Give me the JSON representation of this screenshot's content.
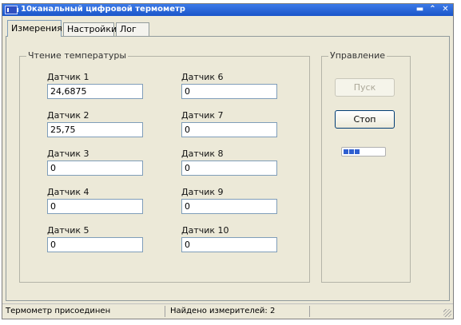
{
  "window": {
    "title": "10канальный цифровой термометр",
    "buttons": {
      "minimize": "▬",
      "maximize": "⌃",
      "close": "✕"
    }
  },
  "tabs": [
    {
      "label": "Измерения"
    },
    {
      "label": "Настройки"
    },
    {
      "label": "Лог"
    }
  ],
  "measurements": {
    "group_title": "Чтение температуры",
    "sensors": [
      {
        "label": "Датчик 1",
        "value": "24,6875"
      },
      {
        "label": "Датчик 2",
        "value": "25,75"
      },
      {
        "label": "Датчик 3",
        "value": "0"
      },
      {
        "label": "Датчик 4",
        "value": "0"
      },
      {
        "label": "Датчик 5",
        "value": "0"
      },
      {
        "label": "Датчик 6",
        "value": "0"
      },
      {
        "label": "Датчик 7",
        "value": "0"
      },
      {
        "label": "Датчик 8",
        "value": "0"
      },
      {
        "label": "Датчик 9",
        "value": "0"
      },
      {
        "label": "Датчик 10",
        "value": "0"
      }
    ]
  },
  "control": {
    "group_title": "Управление",
    "start_label": "Пуск",
    "stop_label": "Стоп",
    "progress_blocks_filled": 3
  },
  "status": {
    "connection": "Термометр присоединен",
    "found": "Найдено измерителей: 2"
  },
  "colors": {
    "titlebar": "#1b55c9",
    "progress": "#2f5fd0"
  }
}
